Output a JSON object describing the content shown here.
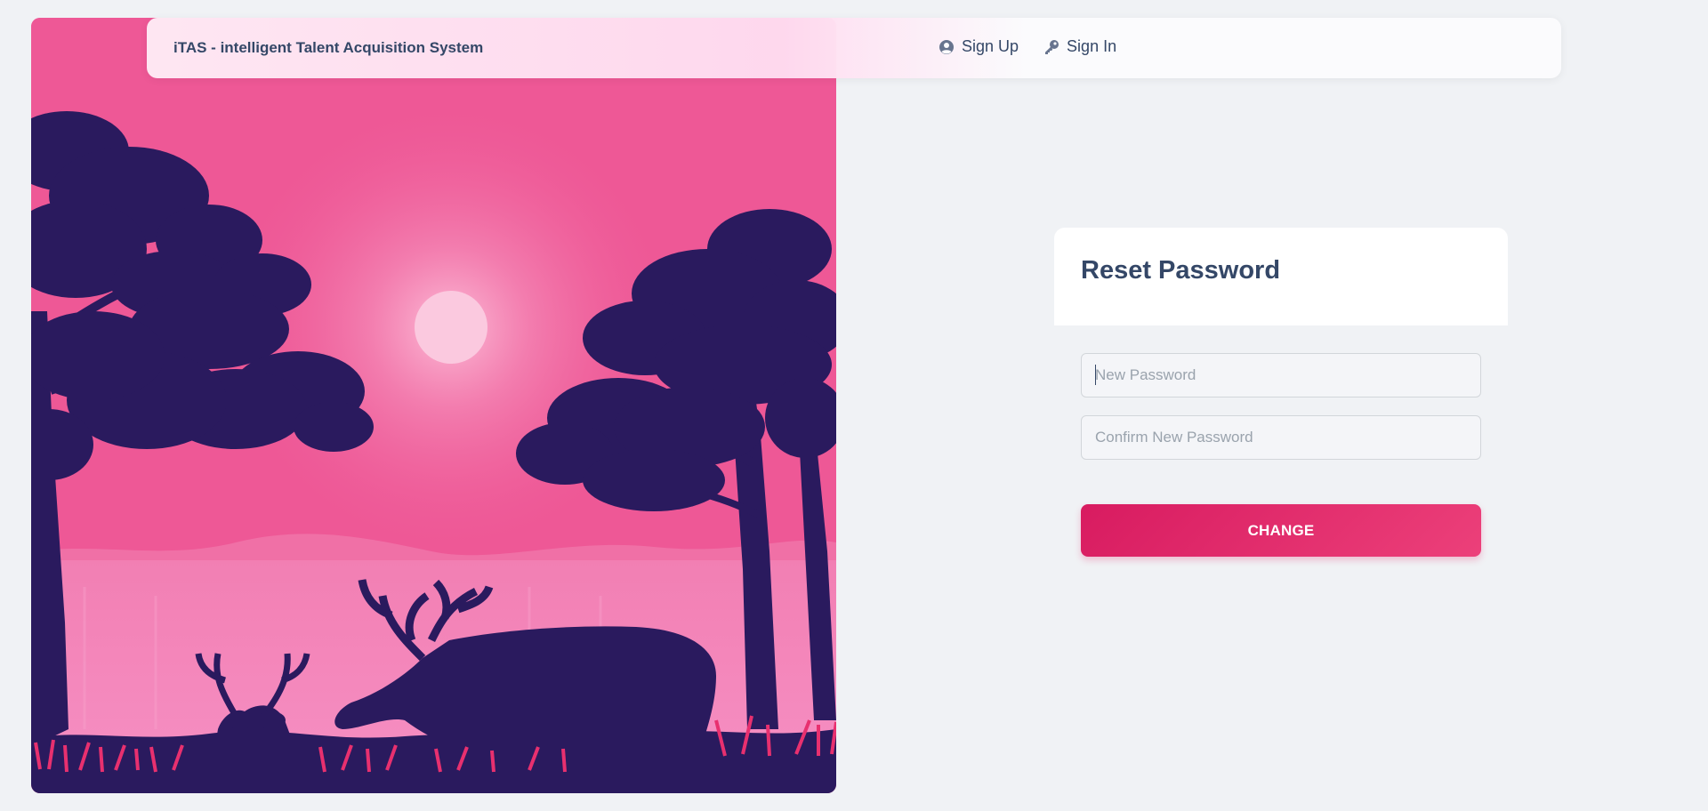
{
  "navbar": {
    "brand": "iTAS - intelligent Talent Acquisition System",
    "links": [
      {
        "label": "Sign Up",
        "icon": "user-circle-icon"
      },
      {
        "label": "Sign In",
        "icon": "key-icon"
      }
    ]
  },
  "illustration": {
    "subject": "deer-forest-sunset-illustration"
  },
  "form": {
    "title": "Reset Password",
    "new_password_placeholder": "New Password",
    "new_password_value": "",
    "confirm_password_placeholder": "Confirm New Password",
    "confirm_password_value": "",
    "submit_label": "CHANGE"
  },
  "colors": {
    "accent": "#e91e63",
    "sky": "#ee5896",
    "silhouette": "#2a1a5e",
    "text": "#344767",
    "background": "#f0f2f5"
  }
}
